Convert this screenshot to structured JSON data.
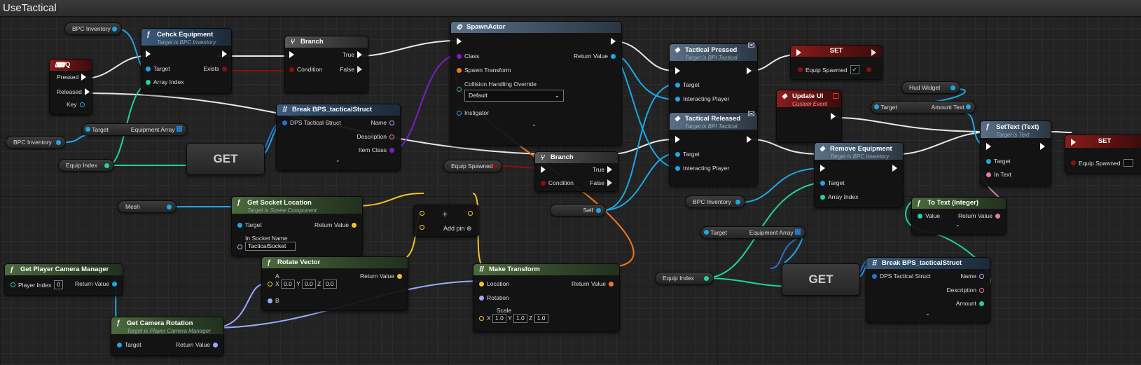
{
  "title": "UseTactical",
  "colors": {
    "exec": "#ffffff",
    "object": "#1ea7e8",
    "bool": "#8a0f0f",
    "int": "#21d39c",
    "struct_transform": "#f07a1a",
    "struct": "#2a6fd6",
    "vector": "#f2c12e",
    "rotator": "#9fa9ff",
    "text": "#e07fa8",
    "class": "#7a1ec8"
  },
  "nodes": {
    "q_key": {
      "title": "Q",
      "pressed": "Pressed",
      "released": "Released",
      "key": "Key"
    },
    "check_equipment": {
      "title": "Cehck Equipment",
      "subtitle": "Target is BPC Inventory",
      "target": "Target",
      "exists": "Exists",
      "array_index": "Array Index"
    },
    "branch1": {
      "title": "Branch",
      "condition": "Condition",
      "true": "True",
      "false": "False"
    },
    "spawn_actor": {
      "title": "SpawnActor",
      "class": "Class",
      "spawn_transform": "Spawn Transform",
      "collision": "Collision Handling Override",
      "collision_value": "Default",
      "instigator": "Instigator",
      "return_value": "Return Value"
    },
    "tactical_pressed": {
      "title": "Tactical Pressed",
      "subtitle": "Target is BPI Tactical",
      "target": "Target",
      "interacting_player": "Interacting Player"
    },
    "set1": {
      "title": "SET",
      "label": "Equip Spawned"
    },
    "update_ui": {
      "title": "Update UI",
      "subtitle": "Custom Event"
    },
    "tactical_released": {
      "title": "Tactical Released",
      "subtitle": "Target is BPI Tactical",
      "target": "Target",
      "interacting_player": "Interacting Player"
    },
    "break_struct1": {
      "title": "Break BPS_tacticalStruct",
      "struct": "DPS Tactical Struct",
      "name": "Name",
      "description": "Description",
      "item_class": "Item Class"
    },
    "branch2": {
      "title": "Branch",
      "condition": "Condition",
      "true": "True",
      "false": "False"
    },
    "get_socket": {
      "title": "Get Socket Location",
      "subtitle": "Target is Scene Component",
      "target": "Target",
      "socket_name": "In Socket Name",
      "socket_value": "TacticalSocket",
      "return_value": "Return Value"
    },
    "add_node": {
      "plus": "+",
      "add_pin": "Add pin"
    },
    "rotate_vector": {
      "title": "Rotate Vector",
      "a": "A",
      "b": "B",
      "x": "0.0",
      "y": "0.0",
      "z": "0.0",
      "return_value": "Return Value"
    },
    "make_transform": {
      "title": "Make Transform",
      "location": "Location",
      "rotation": "Rotation",
      "scale": "Scale",
      "sx": "1.0",
      "sy": "1.0",
      "sz": "1.0",
      "return_value": "Return Value"
    },
    "camera_manager": {
      "title": "Get Player Camera Manager",
      "player_index": "Player Index",
      "player_index_value": "0",
      "return_value": "Return Value"
    },
    "camera_rotation": {
      "title": "Get Camera Rotation",
      "subtitle": "Target is Player Camera Manager",
      "target": "Target",
      "return_value": "Return Value"
    },
    "remove_equipment": {
      "title": "Remove Equipment",
      "subtitle": "Target is BPC Inventory",
      "target": "Target",
      "array_index": "Array Index"
    },
    "settext": {
      "title": "SetText (Text)",
      "subtitle": "Target is Text",
      "target": "Target",
      "in_text": "In Text"
    },
    "set2": {
      "title": "SET",
      "label": "Equip Spawned"
    },
    "to_text": {
      "title": "To Text (Integer)",
      "value": "Value",
      "return_value": "Return Value"
    },
    "break_struct2": {
      "title": "Break BPS_tacticalStruct",
      "struct": "DPS Tactical Struct",
      "name": "Name",
      "description": "Description",
      "amount": "Amount"
    }
  },
  "vars": {
    "bpc_inventory_1": "BPC Inventory",
    "bpc_inventory_2": "BPC Inventory",
    "bpc_inventory_3": "BPC Inventory",
    "equip_index_1": "Equip Index",
    "equip_index_2": "Equip Index",
    "equip_spawned": "Equip Spawned",
    "mesh": "Mesh",
    "self": "Self",
    "hud_widget": "Hud Widget",
    "target": "Target",
    "equipment_array": "Equipment Array",
    "amount_text": "Amount Text",
    "get": "GET"
  }
}
